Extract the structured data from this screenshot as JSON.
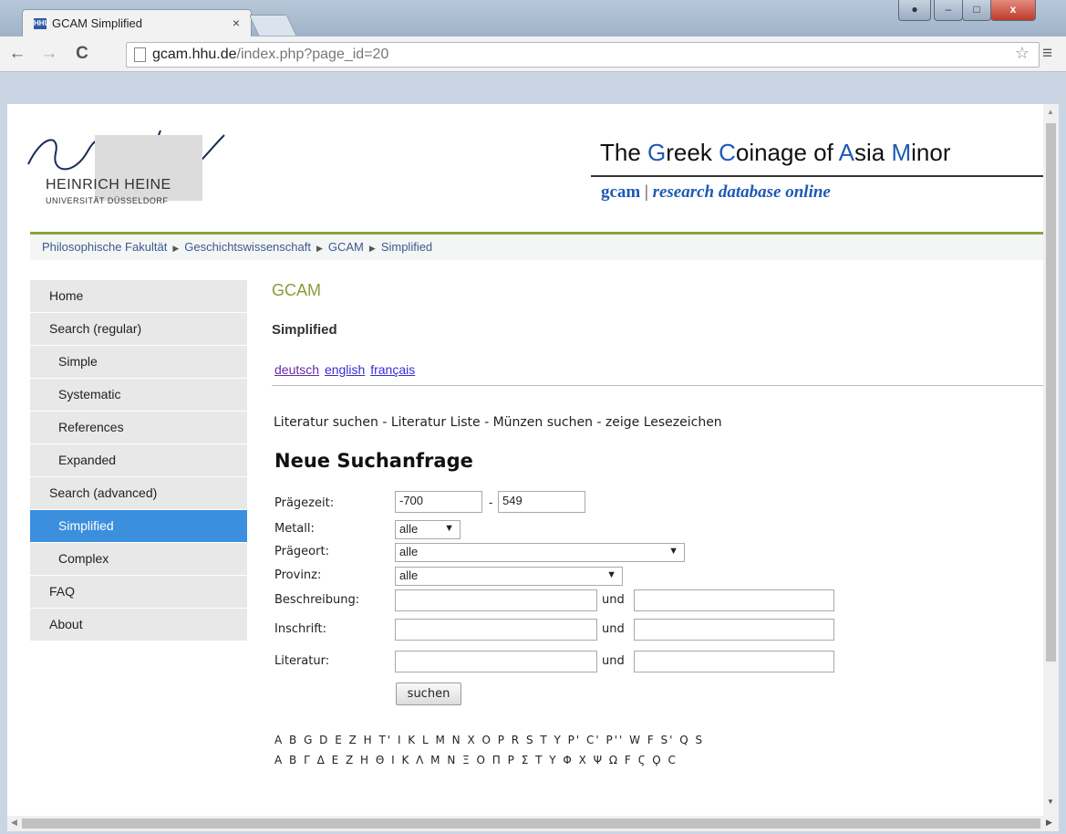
{
  "browser": {
    "tab_title": "GCAM Simplified",
    "tab_close": "×",
    "url_host": "gcam.hhu.de",
    "url_path": "/index.php?page_id=20",
    "back": "←",
    "forward": "→",
    "reload": "C",
    "star": "☆",
    "menu": "≡",
    "win_minimize": "–",
    "win_maximize": "□",
    "win_close": "x"
  },
  "header": {
    "logo_name": "HEINRICH HEINE",
    "logo_sub": "UNIVERSITÄT DÜSSELDORF",
    "title_parts": [
      "The ",
      "G",
      "reek ",
      "C",
      "oinage of ",
      "A",
      "sia ",
      "M",
      "inor"
    ],
    "tagline_a": "gcam",
    "tagline_sep": " | ",
    "tagline_b": "research database online",
    "accent_color": "#1e5ab4",
    "rule_color": "#8ca23c"
  },
  "breadcrumb": [
    "Philosophische Fakultät",
    "Geschichtswissenschaft",
    "GCAM",
    "Simplified"
  ],
  "sidebar": {
    "items": [
      {
        "label": "Home",
        "sub": false,
        "active": false
      },
      {
        "label": "Search (regular)",
        "sub": false,
        "active": false
      },
      {
        "label": "Simple",
        "sub": true,
        "active": false
      },
      {
        "label": "Systematic",
        "sub": true,
        "active": false
      },
      {
        "label": "References",
        "sub": true,
        "active": false
      },
      {
        "label": "Expanded",
        "sub": true,
        "active": false
      },
      {
        "label": "Search (advanced)",
        "sub": false,
        "active": false
      },
      {
        "label": "Simplified",
        "sub": true,
        "active": true
      },
      {
        "label": "Complex",
        "sub": true,
        "active": false
      },
      {
        "label": "FAQ",
        "sub": false,
        "active": false
      },
      {
        "label": "About",
        "sub": false,
        "active": false
      }
    ]
  },
  "content": {
    "heading": "GCAM",
    "subheading": "Simplified",
    "languages": [
      "deutsch",
      "english",
      "français"
    ],
    "links_line": "Literatur suchen - Literatur Liste - Münzen suchen - zeige Lesezeichen",
    "form_title": "Neue Suchanfrage",
    "form": {
      "praegezeit_label": "Prägezeit:",
      "praegezeit_from": "-700",
      "praegezeit_sep": "-",
      "praegezeit_to": "549",
      "metall_label": "Metall:",
      "metall_value": "alle",
      "praegeort_label": "Prägeort:",
      "praegeort_value": "alle",
      "provinz_label": "Provinz:",
      "provinz_value": "alle",
      "beschreibung_label": "Beschreibung:",
      "inschrift_label": "Inschrift:",
      "literatur_label": "Literatur:",
      "und": "und",
      "submit": "suchen"
    },
    "latin_alphabet": "A B G D E Z H T' I K L M N X O P R S T Y P' C' P'' W F S' Q S",
    "greek_alphabet": "Α Β Γ Δ Ε Ζ Η Θ Ι Κ Λ Μ Ν Ξ Ο Π Ρ Σ Τ Υ Φ Χ Ψ Ω Ϝ Ϛ Ϙ Ϲ"
  }
}
